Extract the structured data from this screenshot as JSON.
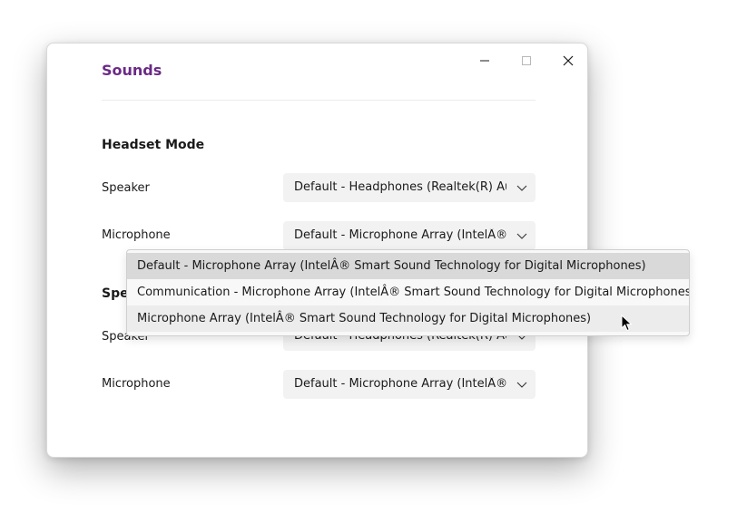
{
  "window": {
    "title": "Sounds",
    "controls": {
      "minimize_icon": "minimize-icon",
      "maximize_icon": "maximize-icon",
      "close_icon": "close-icon"
    }
  },
  "headset_mode": {
    "heading": "Headset Mode",
    "speaker": {
      "label": "Speaker",
      "value": "Default - Headphones (Realtek(R) Audio)"
    },
    "microphone": {
      "label": "Microphone",
      "value": "Default - Microphone Array (IntelÂ® Smart Sound Technology for Digital Microphones)"
    }
  },
  "speaker_mode": {
    "heading": "Speaker Mode",
    "speaker": {
      "label": "Speaker",
      "value": "Default - Headphones (Realtek(R) Audio)"
    },
    "microphone": {
      "label": "Microphone",
      "value": "Default - Microphone Array (IntelÂ® Smart Sound Technology for Digital Microphones)"
    }
  },
  "microphone_dropdown": {
    "options": [
      "Default - Microphone Array (IntelÂ® Smart Sound Technology for Digital Microphones)",
      "Communication - Microphone Array (IntelÂ® Smart Sound Technology for Digital Microphones)",
      "Microphone Array (IntelÂ® Smart Sound Technology for Digital Microphones)"
    ],
    "selected_index": 0,
    "hovered_index": 2
  },
  "colors": {
    "title": "#6b2a86",
    "combo_background": "#f2f2f2",
    "selected_option": "#d9d9d9",
    "hovered_option": "#ececec"
  }
}
